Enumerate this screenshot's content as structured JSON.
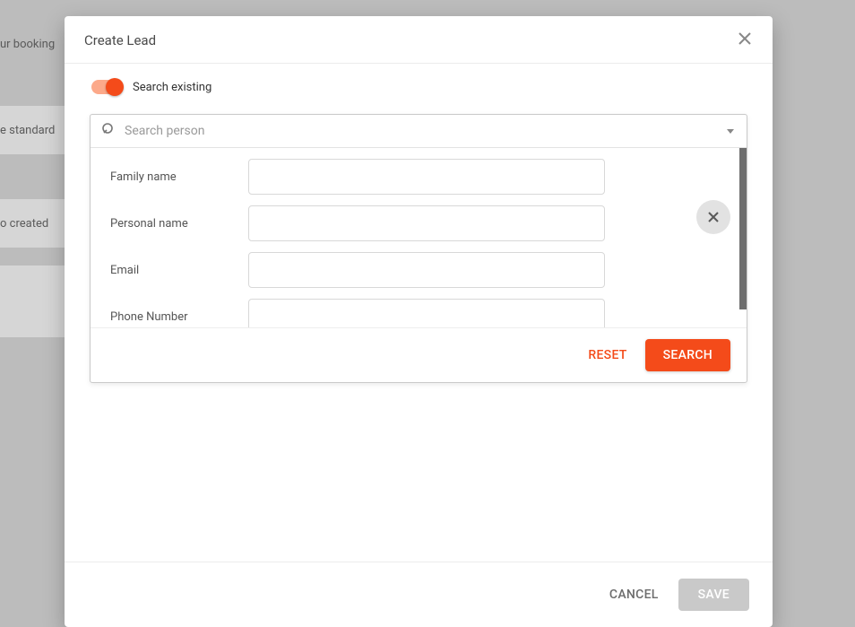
{
  "background": {
    "top_text": "ur booking",
    "strip1": "e standard",
    "strip2": "o created",
    "strip3": ""
  },
  "modal": {
    "title": "Create Lead",
    "toggle_label": "Search existing",
    "search": {
      "placeholder": "Search person"
    },
    "fields": {
      "family_name": {
        "label": "Family name",
        "value": ""
      },
      "personal_name": {
        "label": "Personal name",
        "value": ""
      },
      "email": {
        "label": "Email",
        "value": ""
      },
      "phone": {
        "label": "Phone Number",
        "value": ""
      }
    },
    "actions": {
      "reset": "RESET",
      "search": "SEARCH"
    },
    "footer": {
      "cancel": "CANCEL",
      "save": "SAVE"
    }
  }
}
